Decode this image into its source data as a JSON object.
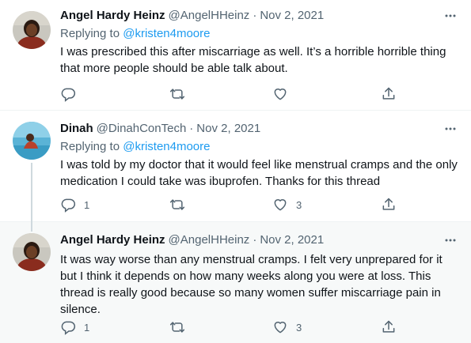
{
  "tweets": [
    {
      "name": "Angel Hardy Heinz",
      "handle": "@AngelHHeinz",
      "separator": "·",
      "date": "Nov 2, 2021",
      "replying_prefix": "Replying to ",
      "replying_to": "@kristen4moore",
      "text_lines": [
        "I was prescribed this after miscarriage as well. It’s a horrible horrible thing",
        "that more people should be able talk about."
      ],
      "reply_count": "",
      "retweet_count": "",
      "like_count": ""
    },
    {
      "name": "Dinah",
      "handle": "@DinahConTech",
      "separator": "·",
      "date": "Nov 2, 2021",
      "replying_prefix": "Replying to ",
      "replying_to": "@kristen4moore",
      "text_lines": [
        "I was told by my doctor that it would feel like menstrual cramps and the only",
        "medication I could take was ibuprofen. Thanks for this thread"
      ],
      "reply_count": "1",
      "retweet_count": "",
      "like_count": "3"
    },
    {
      "name": "Angel Hardy Heinz",
      "handle": "@AngelHHeinz",
      "separator": "·",
      "date": "Nov 2, 2021",
      "text_lines": [
        "It was way worse than any menstrual cramps. I felt very unprepared for it",
        "but I think it depends on how many weeks along you were at loss. This",
        "thread is really good because so many women suffer miscarriage pain in",
        "silence."
      ],
      "reply_count": "1",
      "retweet_count": "",
      "like_count": "3"
    }
  ],
  "icons": {
    "more": "more-horizontal-icon",
    "reply": "reply-icon",
    "retweet": "retweet-icon",
    "like": "heart-icon",
    "share": "share-icon"
  },
  "colors": {
    "link": "#1d9bf0",
    "secondary_text": "#536471",
    "highlight_bg": "#f7f9f9",
    "thread_line": "#cfd9de"
  }
}
